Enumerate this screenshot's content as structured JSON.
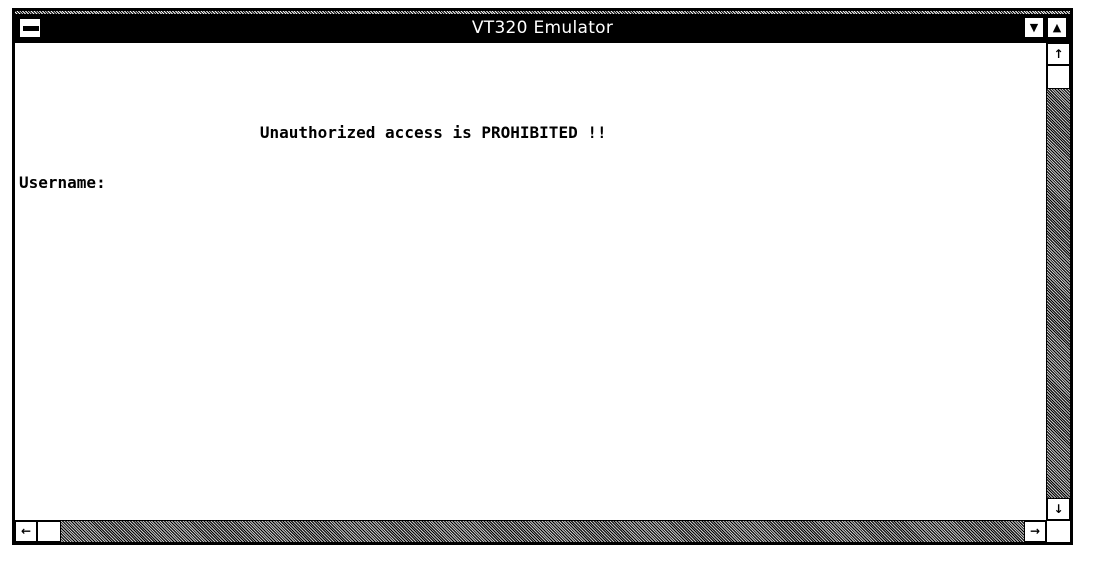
{
  "window": {
    "title": "VT320 Emulator"
  },
  "titlebar": {
    "system_menu_icon": "system-menu-icon",
    "minimize_glyph": "▼",
    "maximize_glyph": "▲"
  },
  "terminal": {
    "lines": [
      "                         Unauthorized access is PROHIBITED !!",
      "Username:"
    ]
  },
  "scrollbars": {
    "vertical": {
      "up_glyph": "↑",
      "down_glyph": "↓",
      "position": 0
    },
    "horizontal": {
      "left_glyph": "←",
      "right_glyph": "→",
      "position": 0
    }
  },
  "colors": {
    "titlebar_bg": "#000000",
    "titlebar_text": "#ffffff",
    "client_bg": "#ffffff",
    "text": "#000000"
  }
}
